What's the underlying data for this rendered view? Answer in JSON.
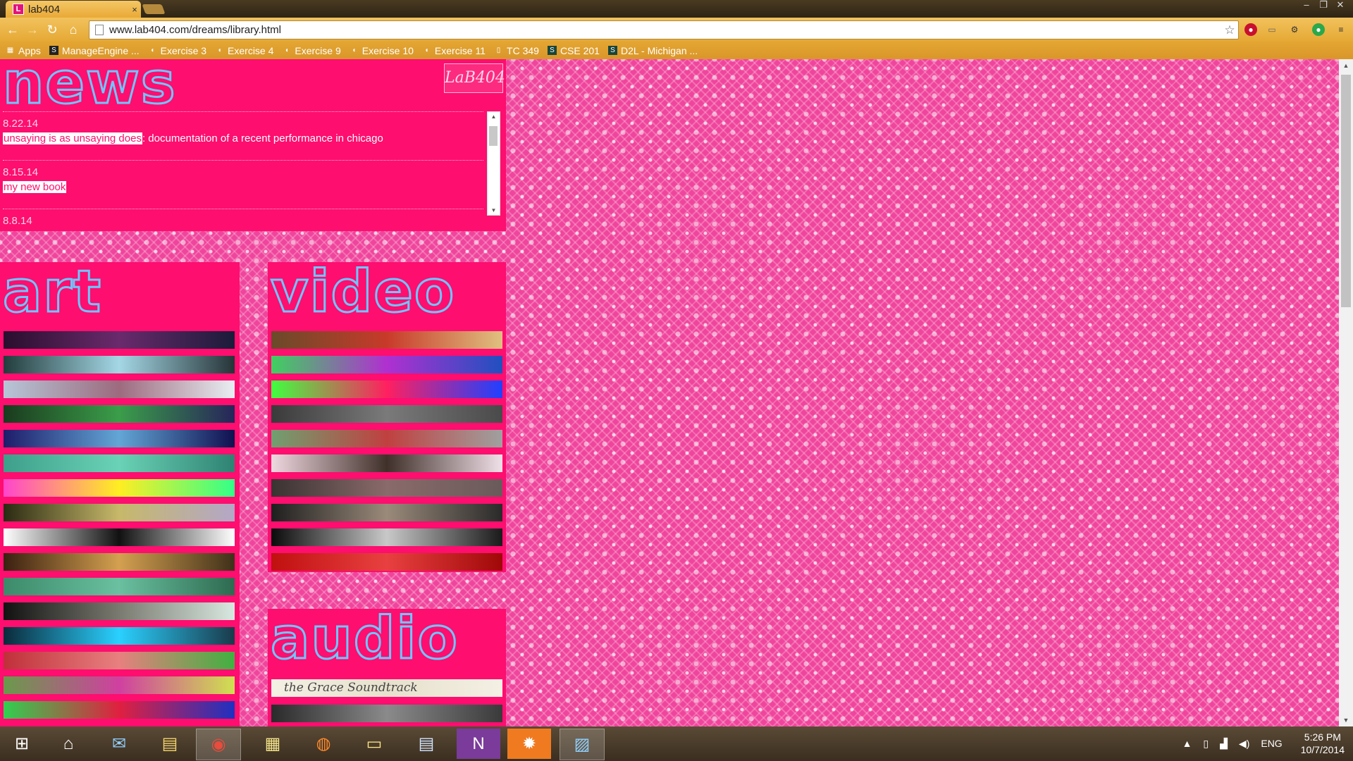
{
  "browser": {
    "tab_title": "lab404",
    "tab_close": "×",
    "url": "www.lab404.com/dreams/library.html",
    "window_controls": [
      "–",
      "❐",
      "✕"
    ],
    "bookmarks": [
      {
        "label": "Apps",
        "icon": "apps-grid-icon"
      },
      {
        "label": "ManageEngine ...",
        "icon": "manageengine-icon"
      },
      {
        "label": "Exercise 3",
        "icon": "spartan-helmet-icon"
      },
      {
        "label": "Exercise 4",
        "icon": "spartan-helmet-icon"
      },
      {
        "label": "Exercise 9",
        "icon": "spartan-helmet-icon"
      },
      {
        "label": "Exercise 10",
        "icon": "spartan-helmet-icon"
      },
      {
        "label": "Exercise 11",
        "icon": "spartan-helmet-icon"
      },
      {
        "label": "TC 349",
        "icon": "page-icon"
      },
      {
        "label": "CSE 201",
        "icon": "s-logo-icon"
      },
      {
        "label": "D2L - Michigan ...",
        "icon": "s-logo-icon"
      }
    ]
  },
  "page": {
    "news": {
      "title": "news",
      "logo_text": "LaB404",
      "items": [
        {
          "date": "8.22.14",
          "link": "unsaying is as unsaying does",
          "text": ": documentation of a recent performance in chicago"
        },
        {
          "date": "8.15.14",
          "link": "my new book",
          "text": ""
        },
        {
          "date": "8.8.14",
          "link": "",
          "text": ""
        }
      ]
    },
    "art": {
      "title": "art",
      "strips": [
        [
          "#2a0e2e",
          "#6a2a6c",
          "#1b1b3a"
        ],
        [
          "#223c3c",
          "#a4d7e5",
          "#263437"
        ],
        [
          "#b7c6d8",
          "#9d6a7e",
          "#e9eef3"
        ],
        [
          "#1a3a1e",
          "#3b9d4a",
          "#27245a"
        ],
        [
          "#1e1c6a",
          "#63a6d6",
          "#101050"
        ],
        [
          "#3e9f8a",
          "#6ad2b6",
          "#2f8272"
        ],
        [
          "#ff44cc",
          "#ffee22",
          "#33ff88"
        ],
        [
          "#2a2a12",
          "#c7b86a",
          "#b3a7c8"
        ],
        [
          "#ffffff",
          "#111111",
          "#ffffff"
        ],
        [
          "#3a2010",
          "#d4a050",
          "#40301a"
        ],
        [
          "#3c8a6a",
          "#6ac0a0",
          "#2e6a50"
        ],
        [
          "#111111",
          "#7a7a70",
          "#d8e8e0"
        ],
        [
          "#0b2a3a",
          "#2ad0ff",
          "#1a3a4a"
        ],
        [
          "#c0303a",
          "#e88080",
          "#40b040"
        ],
        [
          "#6a9a4a",
          "#d040a0",
          "#d0e050"
        ],
        [
          "#30d050",
          "#e02040",
          "#2030c0"
        ]
      ]
    },
    "video": {
      "title": "video",
      "strips": [
        [
          "#6a4a2a",
          "#c83a2a",
          "#e0c080"
        ],
        [
          "#40d060",
          "#b030d0",
          "#2050c0"
        ],
        [
          "#40ff40",
          "#ff2060",
          "#2040ff"
        ],
        [
          "#3a3a3a",
          "#7a7a7a",
          "#4a4a4a"
        ],
        [
          "#70a070",
          "#c04040",
          "#a0a0a0"
        ],
        [
          "#f0d8e0",
          "#40302a",
          "#f0e0e8"
        ],
        [
          "#3a3232",
          "#8a6a6a",
          "#6a5a5a"
        ],
        [
          "#1e1e1e",
          "#9a8a7a",
          "#2a2a2a"
        ],
        [
          "#0a0a0a",
          "#c8c8c8",
          "#1a1a1a"
        ],
        [
          "#c01010",
          "#e84040",
          "#a00808"
        ]
      ]
    },
    "audio": {
      "title": "audio",
      "strips": [
        {
          "label": "the Grace Soundtrack",
          "colors": [
            "#f4f0e4",
            "#e6e0cc",
            "#f4f0e4"
          ]
        },
        {
          "label": "",
          "colors": [
            "#2a2a2a",
            "#8a8a8a",
            "#3a3a3a"
          ]
        }
      ]
    }
  },
  "taskbar": {
    "apps": [
      {
        "name": "start-button",
        "glyph": "⊞"
      },
      {
        "name": "home-app",
        "glyph": "⌂"
      },
      {
        "name": "mail-app",
        "glyph": "✉"
      },
      {
        "name": "file-explorer-app",
        "glyph": "▤"
      },
      {
        "name": "chrome-app",
        "glyph": "◉"
      },
      {
        "name": "python-app",
        "glyph": "▦"
      },
      {
        "name": "firefox-app",
        "glyph": "◍"
      },
      {
        "name": "sticky-notes-app",
        "glyph": "▭"
      },
      {
        "name": "document-app",
        "glyph": "▤"
      },
      {
        "name": "onenote-app",
        "glyph": "N"
      },
      {
        "name": "settings-app",
        "glyph": "✹"
      },
      {
        "name": "photos-app",
        "glyph": "▨"
      }
    ],
    "tray": {
      "show_hidden": "▲",
      "language": "ENG",
      "time": "5:26 PM",
      "date": "10/7/2014"
    }
  }
}
